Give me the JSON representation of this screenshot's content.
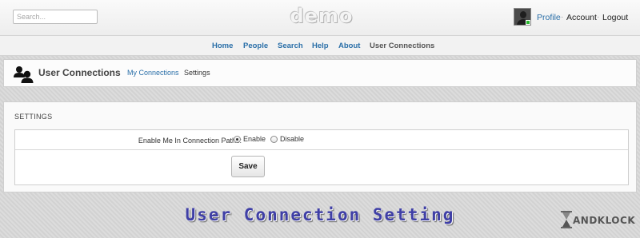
{
  "header": {
    "search_placeholder": "Search...",
    "logo": "demo",
    "links": {
      "profile": "Profile",
      "account": "Account",
      "logout": "Logout"
    },
    "separator": "·"
  },
  "nav": {
    "items": [
      "Home",
      "People",
      "Search",
      "Help",
      "About",
      "User Connections"
    ],
    "current": "User Connections",
    "link_color": "#2a6fa8"
  },
  "page": {
    "title": "User Connections",
    "breadcrumb": {
      "link": "My Connections",
      "separator": "›",
      "current": "Settings"
    }
  },
  "settings": {
    "section_title": "SETTINGS",
    "field_label": "Enable Me In Connection Paths:",
    "options": [
      "Enable",
      "Disable"
    ],
    "selected": "Enable",
    "save_label": "Save"
  },
  "caption": "User Connection Setting",
  "watermark": "ANDKLOCK",
  "icons": {
    "avatar": "user-avatar-icon",
    "people": "people-icon",
    "hourglass": "hourglass-icon"
  }
}
